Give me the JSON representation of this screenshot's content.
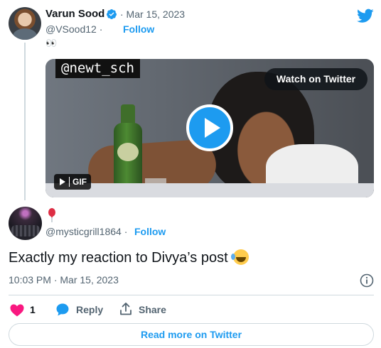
{
  "author": {
    "name": "Varun Sood",
    "date": "· Mar 15, 2023",
    "handle": "@VSood12 ·",
    "follow_label": "Follow",
    "text": "👀"
  },
  "media": {
    "watermark": "@newt_sch",
    "watch_label": "Watch on Twitter",
    "gif_label": "GIF",
    "icons": [
      "play-icon",
      "gif-play-icon"
    ]
  },
  "reply": {
    "name_icon": "balloon-icon",
    "handle": "@mysticgrill1864 ·",
    "follow_label": "Follow",
    "text": "Exactly my reaction to Divya’s post",
    "emoji": "rolling-on-floor-laughing",
    "timestamp": "10:03 PM · Mar 15, 2023"
  },
  "actions": {
    "like_count": "1",
    "reply_label": "Reply",
    "share_label": "Share"
  },
  "read_more_label": "Read more on Twitter",
  "colors": {
    "accent": "#1d9bf0",
    "heart": "#f91880",
    "muted": "#536471",
    "border": "#cfd9de"
  }
}
